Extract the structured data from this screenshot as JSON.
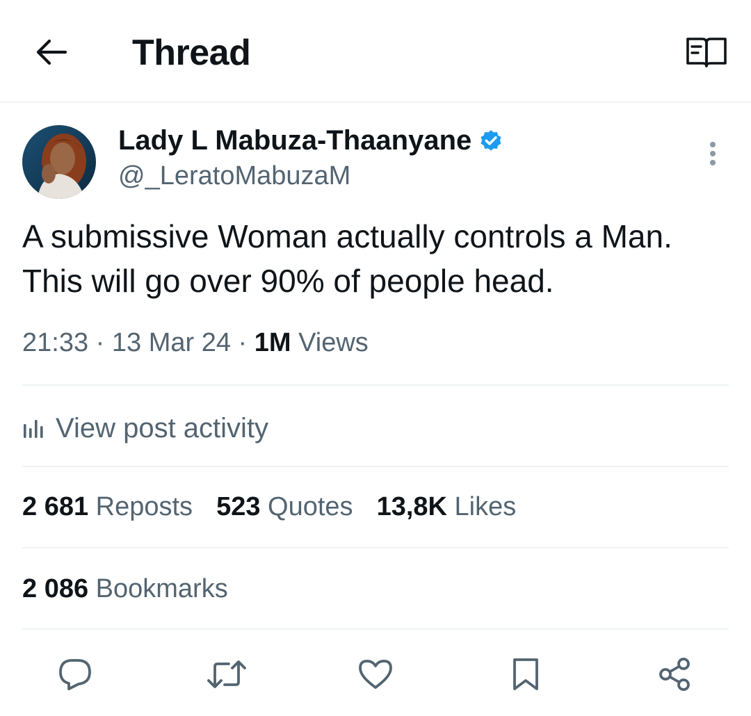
{
  "header": {
    "title": "Thread",
    "back_icon": "arrow-left-icon",
    "reader_icon": "book-open-icon"
  },
  "tweet": {
    "author": {
      "display_name": "Lady L Mabuza-Thaanyane",
      "handle": "@_LeratoMabuzaM",
      "verified": true,
      "verified_color": "#1d9bf0"
    },
    "text": "A submissive Woman actually controls a Man. This will go over 90% of people head.",
    "time": "21:33",
    "date": "13 Mar 24",
    "views_count": "1M",
    "views_label": "Views",
    "separator": "·"
  },
  "activity": {
    "label": "View post activity",
    "icon": "bar-chart-icon"
  },
  "stats": {
    "reposts_count": "2 681",
    "reposts_label": "Reposts",
    "quotes_count": "523",
    "quotes_label": "Quotes",
    "likes_count": "13,8K",
    "likes_label": "Likes",
    "bookmarks_count": "2 086",
    "bookmarks_label": "Bookmarks"
  },
  "actions": [
    "reply-icon",
    "repost-icon",
    "like-icon",
    "bookmark-icon",
    "share-icon"
  ],
  "colors": {
    "text_primary": "#0f1419",
    "text_secondary": "#536471",
    "divider": "#eff3f4",
    "accent": "#1d9bf0"
  }
}
